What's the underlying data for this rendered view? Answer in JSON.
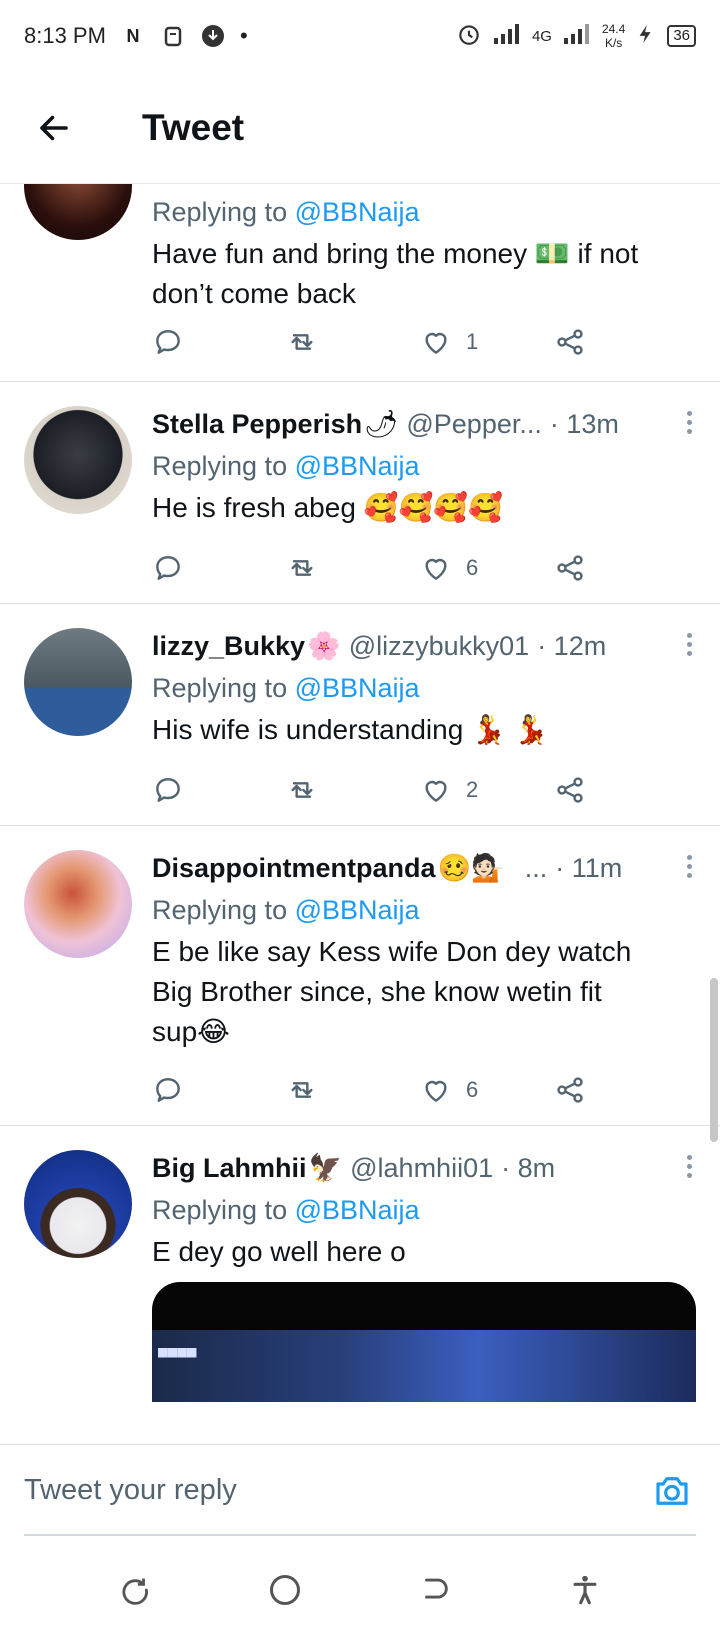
{
  "status_bar": {
    "time": "8:13 PM",
    "network": "4G",
    "speed": "24.4",
    "speed_unit": "K/s",
    "battery": "36"
  },
  "header": {
    "title": "Tweet"
  },
  "reply_prefix": "Replying to ",
  "reply_mention": "@BBNaija",
  "tweets": [
    {
      "name": "",
      "handle": "",
      "time": "",
      "text_line1": "Have fun and bring the money 💵 if not",
      "text_line2": "don’t come back",
      "replies": "",
      "retweets": "",
      "likes": "1",
      "avatar_color": "#3a1e1a"
    },
    {
      "name": "Stella Pepperish",
      "name_emoji": "🌶",
      "handle": "@Pepper...",
      "time": "· 13m",
      "text_line1": "He is fresh abeg 🥰🥰🥰🥰",
      "likes": "6",
      "avatar_color": "#222831"
    },
    {
      "name": "lizzy_Bukky",
      "name_emoji": "🌸",
      "handle": "@lizzybukky01",
      "time": "· 12m",
      "text_line1": "His wife is understanding 💃 💃",
      "likes": "2",
      "avatar_color": "#5d6a73"
    },
    {
      "name": "Disappointmentpanda",
      "name_emoji": "🥴💁🏻",
      "handle": "...",
      "time": "· 11m",
      "text_line1": "E be like say Kess wife Don dey watch",
      "text_line2": "Big Brother since, she know wetin fit",
      "text_line3": "sup😂",
      "likes": "6",
      "avatar_color": "#b79be6"
    },
    {
      "name": "Big Lahmhii",
      "name_emoji": "🦅",
      "handle": "@lahmhii01",
      "time": "· 8m",
      "text_line1": "E dey go well here o",
      "avatar_color": "#1f3fa8"
    }
  ],
  "reply_bar": {
    "placeholder": "Tweet your reply"
  },
  "colors": {
    "accent": "#1d9bf0",
    "secondary_text": "#536471"
  }
}
